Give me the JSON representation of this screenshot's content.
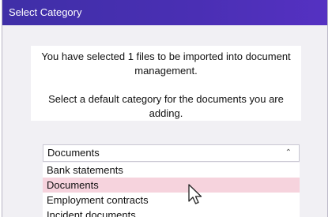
{
  "dialog": {
    "title": "Select Category"
  },
  "message": {
    "line1": "You have selected 1 files to be imported into document management.",
    "line2": "Select a default category for the documents you are adding."
  },
  "category_select": {
    "value": "Documents",
    "chevron_icon": "chevron-up-icon"
  },
  "category_options": [
    {
      "label": "Bank statements",
      "selected": false
    },
    {
      "label": "Documents",
      "selected": true
    },
    {
      "label": "Employment contracts",
      "selected": false
    },
    {
      "label": "Incident documents",
      "selected": false
    }
  ],
  "cursor": {
    "icon": "mouse-pointer-icon"
  },
  "colors": {
    "title_bar": "#4a2fb4",
    "selected_option": "#f6d3dd"
  }
}
